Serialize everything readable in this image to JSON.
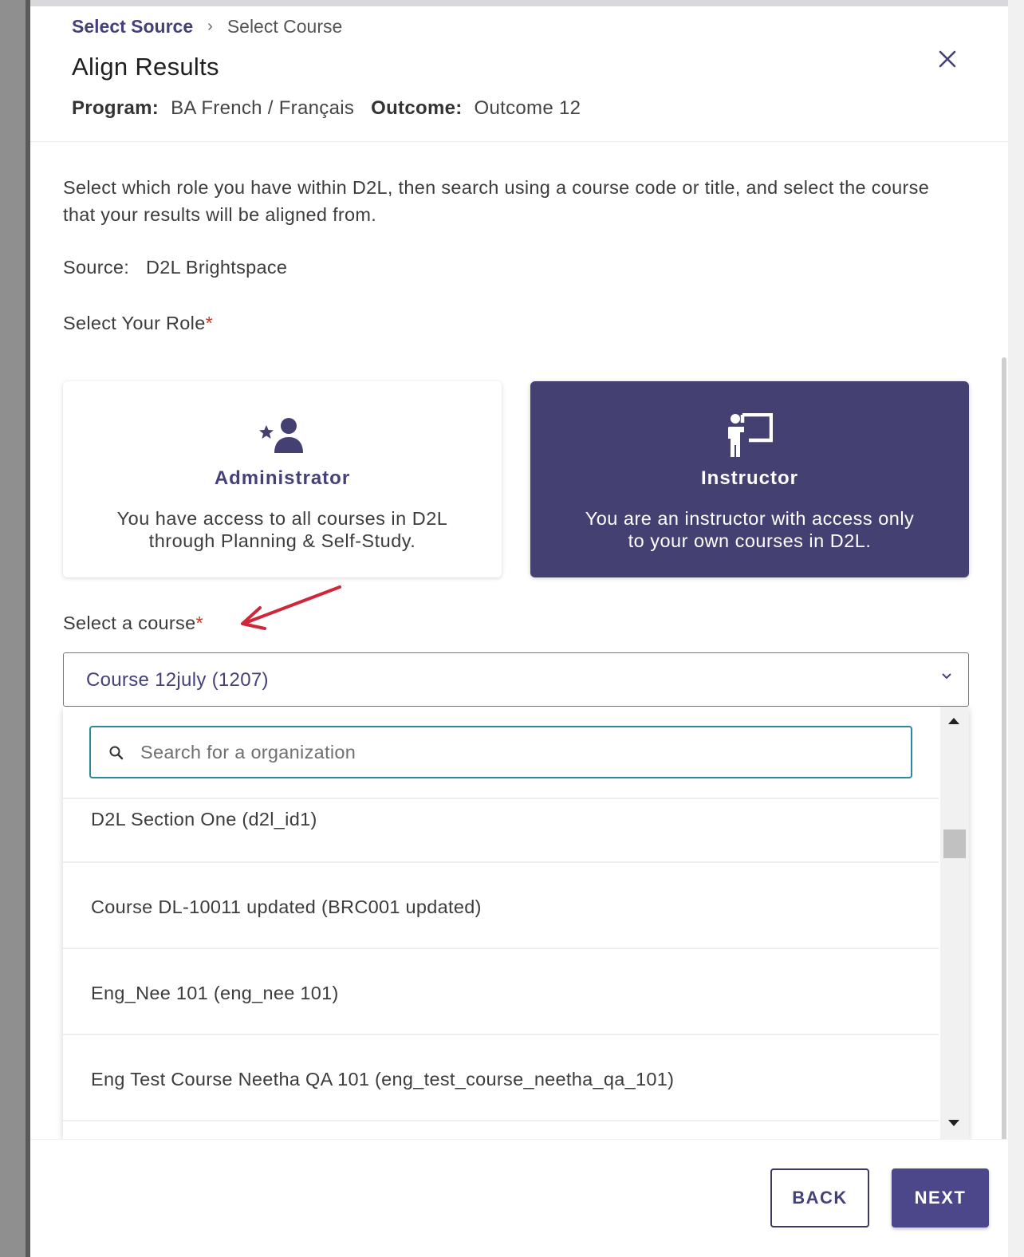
{
  "breadcrumb": {
    "link": "Select Source",
    "separator": "›",
    "current": "Select Course"
  },
  "title": "Align Results",
  "close_icon": "×",
  "meta": {
    "program_label": "Program:",
    "program_value": "BA French / Français",
    "outcome_label": "Outcome:",
    "outcome_value": "Outcome 12"
  },
  "intro": "Select which role you have within D2L, then search using a course code or title, and select the course that your results will be aligned from.",
  "source": {
    "label": "Source:",
    "value": "D2L Brightspace"
  },
  "role": {
    "label": "Select Your Role",
    "required": "*",
    "options": [
      {
        "name": "Administrator",
        "desc_line1": "You have access to all courses in D2L",
        "desc_line2": "through Planning & Self-Study.",
        "icon": "admin-star-user-icon",
        "selected": false
      },
      {
        "name": "Instructor",
        "desc_line1": "You are an instructor with access only",
        "desc_line2": "to your own courses in D2L.",
        "icon": "teacher-board-icon",
        "selected": true
      }
    ]
  },
  "course": {
    "label": "Select a course",
    "required": "*",
    "selected": "Course 12july (1207)",
    "chevron": "⌄",
    "search_placeholder": "Search for a organization",
    "options": [
      "D2L Section One (d2l_id1)",
      "Course DL-10011 updated (BRC001 updated)",
      "Eng_Nee 101 (eng_nee 101)",
      "Eng Test Course Neetha QA 101 (eng_test_course_neetha_qa_101)"
    ]
  },
  "footer": {
    "back": "BACK",
    "next": "NEXT"
  },
  "colors": {
    "primary": "#454072",
    "accent_teal": "#2a8a98",
    "required": "#c0392b",
    "annotation_arrow": "#d0263a"
  }
}
